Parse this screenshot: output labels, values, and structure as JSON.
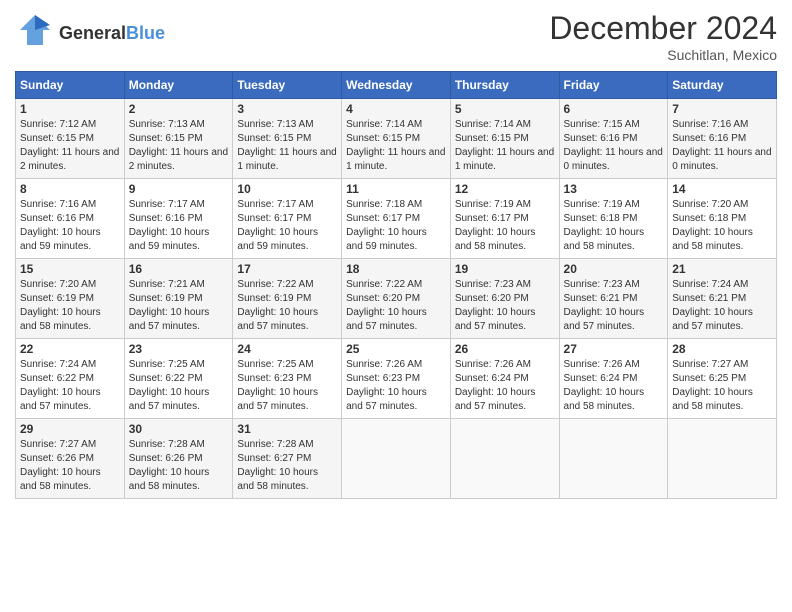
{
  "logo": {
    "general": "General",
    "blue": "Blue"
  },
  "header": {
    "title": "December 2024",
    "subtitle": "Suchitlan, Mexico"
  },
  "days_of_week": [
    "Sunday",
    "Monday",
    "Tuesday",
    "Wednesday",
    "Thursday",
    "Friday",
    "Saturday"
  ],
  "weeks": [
    [
      {
        "day": "1",
        "sunrise": "Sunrise: 7:12 AM",
        "sunset": "Sunset: 6:15 PM",
        "daylight": "Daylight: 11 hours and 2 minutes."
      },
      {
        "day": "2",
        "sunrise": "Sunrise: 7:13 AM",
        "sunset": "Sunset: 6:15 PM",
        "daylight": "Daylight: 11 hours and 2 minutes."
      },
      {
        "day": "3",
        "sunrise": "Sunrise: 7:13 AM",
        "sunset": "Sunset: 6:15 PM",
        "daylight": "Daylight: 11 hours and 1 minute."
      },
      {
        "day": "4",
        "sunrise": "Sunrise: 7:14 AM",
        "sunset": "Sunset: 6:15 PM",
        "daylight": "Daylight: 11 hours and 1 minute."
      },
      {
        "day": "5",
        "sunrise": "Sunrise: 7:14 AM",
        "sunset": "Sunset: 6:15 PM",
        "daylight": "Daylight: 11 hours and 1 minute."
      },
      {
        "day": "6",
        "sunrise": "Sunrise: 7:15 AM",
        "sunset": "Sunset: 6:16 PM",
        "daylight": "Daylight: 11 hours and 0 minutes."
      },
      {
        "day": "7",
        "sunrise": "Sunrise: 7:16 AM",
        "sunset": "Sunset: 6:16 PM",
        "daylight": "Daylight: 11 hours and 0 minutes."
      }
    ],
    [
      {
        "day": "8",
        "sunrise": "Sunrise: 7:16 AM",
        "sunset": "Sunset: 6:16 PM",
        "daylight": "Daylight: 10 hours and 59 minutes."
      },
      {
        "day": "9",
        "sunrise": "Sunrise: 7:17 AM",
        "sunset": "Sunset: 6:16 PM",
        "daylight": "Daylight: 10 hours and 59 minutes."
      },
      {
        "day": "10",
        "sunrise": "Sunrise: 7:17 AM",
        "sunset": "Sunset: 6:17 PM",
        "daylight": "Daylight: 10 hours and 59 minutes."
      },
      {
        "day": "11",
        "sunrise": "Sunrise: 7:18 AM",
        "sunset": "Sunset: 6:17 PM",
        "daylight": "Daylight: 10 hours and 59 minutes."
      },
      {
        "day": "12",
        "sunrise": "Sunrise: 7:19 AM",
        "sunset": "Sunset: 6:17 PM",
        "daylight": "Daylight: 10 hours and 58 minutes."
      },
      {
        "day": "13",
        "sunrise": "Sunrise: 7:19 AM",
        "sunset": "Sunset: 6:18 PM",
        "daylight": "Daylight: 10 hours and 58 minutes."
      },
      {
        "day": "14",
        "sunrise": "Sunrise: 7:20 AM",
        "sunset": "Sunset: 6:18 PM",
        "daylight": "Daylight: 10 hours and 58 minutes."
      }
    ],
    [
      {
        "day": "15",
        "sunrise": "Sunrise: 7:20 AM",
        "sunset": "Sunset: 6:19 PM",
        "daylight": "Daylight: 10 hours and 58 minutes."
      },
      {
        "day": "16",
        "sunrise": "Sunrise: 7:21 AM",
        "sunset": "Sunset: 6:19 PM",
        "daylight": "Daylight: 10 hours and 57 minutes."
      },
      {
        "day": "17",
        "sunrise": "Sunrise: 7:22 AM",
        "sunset": "Sunset: 6:19 PM",
        "daylight": "Daylight: 10 hours and 57 minutes."
      },
      {
        "day": "18",
        "sunrise": "Sunrise: 7:22 AM",
        "sunset": "Sunset: 6:20 PM",
        "daylight": "Daylight: 10 hours and 57 minutes."
      },
      {
        "day": "19",
        "sunrise": "Sunrise: 7:23 AM",
        "sunset": "Sunset: 6:20 PM",
        "daylight": "Daylight: 10 hours and 57 minutes."
      },
      {
        "day": "20",
        "sunrise": "Sunrise: 7:23 AM",
        "sunset": "Sunset: 6:21 PM",
        "daylight": "Daylight: 10 hours and 57 minutes."
      },
      {
        "day": "21",
        "sunrise": "Sunrise: 7:24 AM",
        "sunset": "Sunset: 6:21 PM",
        "daylight": "Daylight: 10 hours and 57 minutes."
      }
    ],
    [
      {
        "day": "22",
        "sunrise": "Sunrise: 7:24 AM",
        "sunset": "Sunset: 6:22 PM",
        "daylight": "Daylight: 10 hours and 57 minutes."
      },
      {
        "day": "23",
        "sunrise": "Sunrise: 7:25 AM",
        "sunset": "Sunset: 6:22 PM",
        "daylight": "Daylight: 10 hours and 57 minutes."
      },
      {
        "day": "24",
        "sunrise": "Sunrise: 7:25 AM",
        "sunset": "Sunset: 6:23 PM",
        "daylight": "Daylight: 10 hours and 57 minutes."
      },
      {
        "day": "25",
        "sunrise": "Sunrise: 7:26 AM",
        "sunset": "Sunset: 6:23 PM",
        "daylight": "Daylight: 10 hours and 57 minutes."
      },
      {
        "day": "26",
        "sunrise": "Sunrise: 7:26 AM",
        "sunset": "Sunset: 6:24 PM",
        "daylight": "Daylight: 10 hours and 57 minutes."
      },
      {
        "day": "27",
        "sunrise": "Sunrise: 7:26 AM",
        "sunset": "Sunset: 6:24 PM",
        "daylight": "Daylight: 10 hours and 58 minutes."
      },
      {
        "day": "28",
        "sunrise": "Sunrise: 7:27 AM",
        "sunset": "Sunset: 6:25 PM",
        "daylight": "Daylight: 10 hours and 58 minutes."
      }
    ],
    [
      {
        "day": "29",
        "sunrise": "Sunrise: 7:27 AM",
        "sunset": "Sunset: 6:26 PM",
        "daylight": "Daylight: 10 hours and 58 minutes."
      },
      {
        "day": "30",
        "sunrise": "Sunrise: 7:28 AM",
        "sunset": "Sunset: 6:26 PM",
        "daylight": "Daylight: 10 hours and 58 minutes."
      },
      {
        "day": "31",
        "sunrise": "Sunrise: 7:28 AM",
        "sunset": "Sunset: 6:27 PM",
        "daylight": "Daylight: 10 hours and 58 minutes."
      },
      null,
      null,
      null,
      null
    ]
  ]
}
